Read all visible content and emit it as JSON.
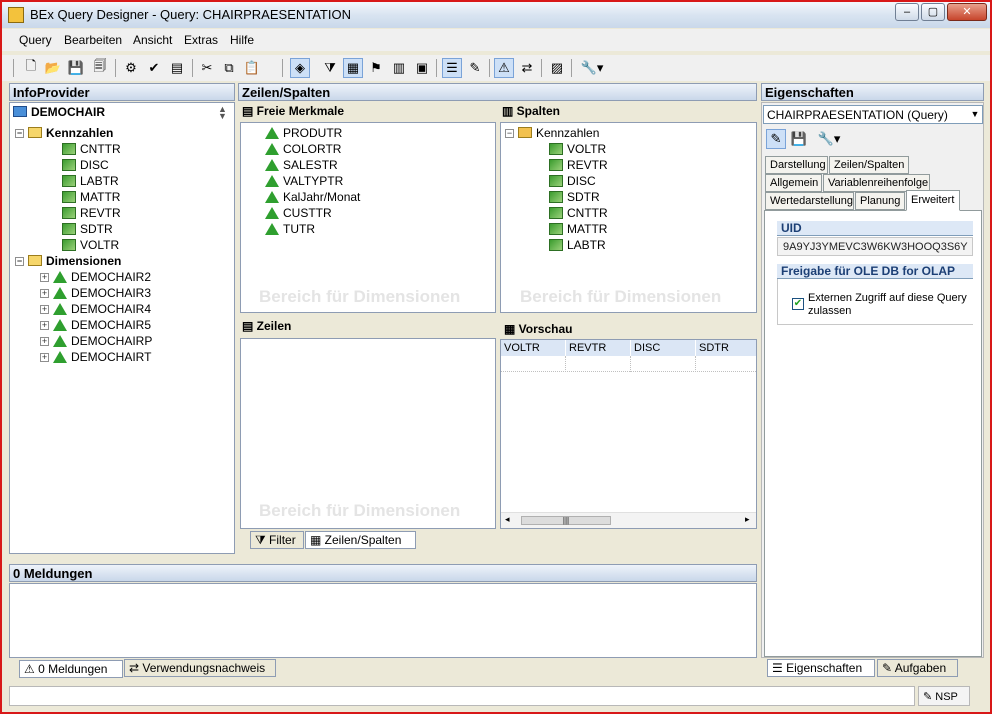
{
  "window": {
    "title": "BEx Query Designer - Query: CHAIRPRAESENTATION",
    "min": "‒",
    "max": "▢",
    "close": "✕"
  },
  "menu": [
    "Query",
    "Bearbeiten",
    "Ansicht",
    "Extras",
    "Hilfe"
  ],
  "infoprovider": {
    "title": "InfoProvider",
    "root": "DEMOCHAIR",
    "kennzahlen_label": "Kennzahlen",
    "kennzahlen": [
      "CNTTR",
      "DISC",
      "LABTR",
      "MATTR",
      "REVTR",
      "SDTR",
      "VOLTR"
    ],
    "dimensionen_label": "Dimensionen",
    "dimensionen": [
      "DEMOCHAIR2",
      "DEMOCHAIR3",
      "DEMOCHAIR4",
      "DEMOCHAIR5",
      "DEMOCHAIRP",
      "DEMOCHAIRT"
    ]
  },
  "zeilen_spalten": {
    "title": "Zeilen/Spalten",
    "freie_merkmale_label": "Freie Merkmale",
    "freie_merkmale": [
      "PRODUTR",
      "COLORTR",
      "SALESTR",
      "VALTYPTR",
      "KalJahr/Monat",
      "CUSTTR",
      "TUTR"
    ],
    "spalten_label": "Spalten",
    "spalten_root": "Kennzahlen",
    "spalten": [
      "VOLTR",
      "REVTR",
      "DISC",
      "SDTR",
      "CNTTR",
      "MATTR",
      "LABTR"
    ],
    "zeilen_label": "Zeilen",
    "vorschau_label": "Vorschau",
    "vorschau_cols": [
      "VOLTR",
      "REVTR",
      "DISC",
      "SDTR"
    ],
    "watermark": "Bereich für Dimensionen",
    "tab_filter": "Filter",
    "tab_zeilen": "Zeilen/Spalten"
  },
  "eigenschaften": {
    "title": "Eigenschaften",
    "selected": "CHAIRPRAESENTATION (Query)",
    "tabs_row1": [
      "Darstellung",
      "Zeilen/Spalten"
    ],
    "tabs_row2": [
      "Allgemein",
      "Variablenreihenfolge"
    ],
    "tabs_row3": [
      "Wertedarstellung",
      "Planung",
      "Erweitert"
    ],
    "uid_label": "UID",
    "uid_value": "9A9YJ3YMEVC3W6KW3HOOQ3S6Y",
    "olap_label": "Freigabe für OLE DB for OLAP",
    "extern_label": "Externen Zugriff auf diese Query zulassen",
    "tab_eig": "Eigenschaften",
    "tab_aufgaben": "Aufgaben"
  },
  "meldungen": {
    "title": "0 Meldungen",
    "tab1": "0 Meldungen",
    "tab2": "Verwendungsnachweis"
  },
  "status": {
    "nsp": "NSP"
  }
}
